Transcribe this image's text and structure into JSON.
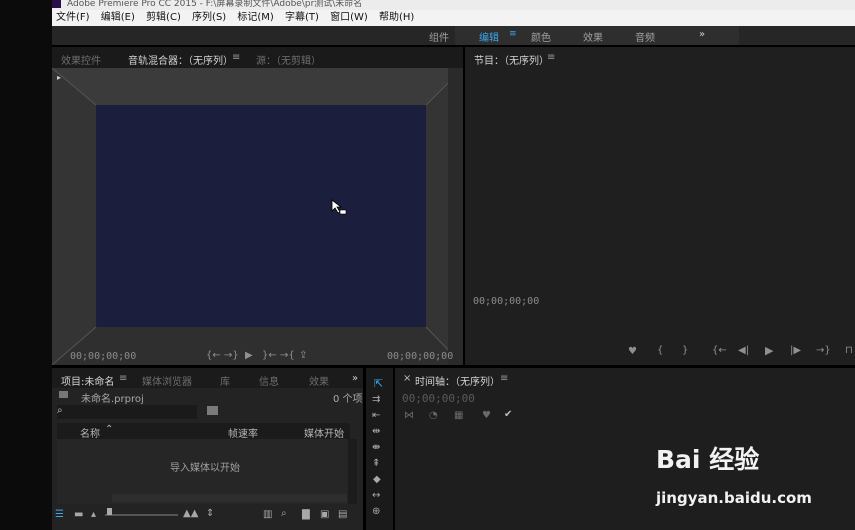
{
  "titlebar": {
    "title": "Adobe Premiere Pro CC 2015 - F:\\屏幕录制文件\\Adobe\\pr测试\\未命名"
  },
  "menu": [
    "文件(F)",
    "编辑(E)",
    "剪辑(C)",
    "序列(S)",
    "标记(M)",
    "字幕(T)",
    "窗口(W)",
    "帮助(H)"
  ],
  "workspaces": {
    "items": [
      "组件",
      "编辑",
      "颜色",
      "效果",
      "音频"
    ],
    "active": "编辑",
    "more": "»"
  },
  "source_panel": {
    "tabs": [
      "效果控件",
      "音轨混合器：（无序列）",
      "源：（无剪辑）"
    ],
    "timecode_left": "00;00;00;00",
    "timecode_right": "00;00;00;00"
  },
  "program_panel": {
    "title": "节目：（无序列）",
    "timecode": "00;00;00;00"
  },
  "project_panel": {
    "tabs": [
      "项目:未命名",
      "媒体浏览器",
      "库",
      "信息",
      "效果"
    ],
    "more": "»",
    "filename": "未命名.prproj",
    "count": "0 个项",
    "columns": [
      "名称",
      "帧速率",
      "媒体开始"
    ],
    "empty_text": "导入媒体以开始"
  },
  "timeline_panel": {
    "title": "时间轴：（无序列）",
    "timecode": "00;00;00;00"
  },
  "watermark": {
    "brand": "Bai 经验",
    "url": "jingyan.baidu.com"
  },
  "colors": {
    "accent": "#3ba6ee",
    "screen": "#1b1e3c"
  }
}
